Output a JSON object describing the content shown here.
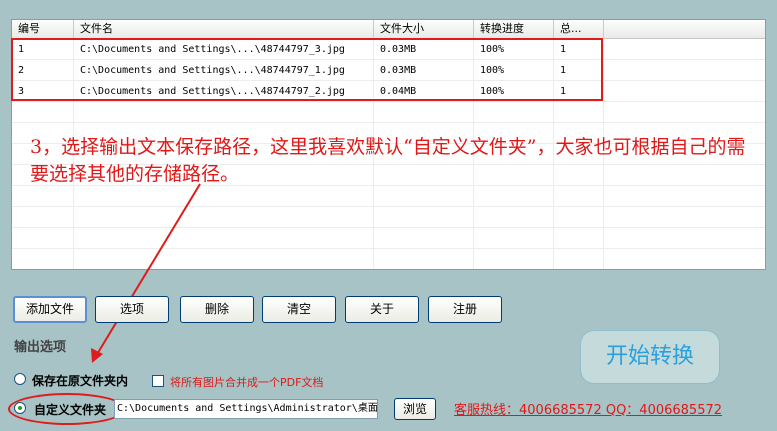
{
  "grid": {
    "columns": [
      "编号",
      "文件名",
      "文件大小",
      "转换进度",
      "总..."
    ],
    "rows": [
      [
        "1",
        "C:\\Documents and Settings\\...\\48744797_3.jpg",
        "0.03MB",
        "100%",
        "1"
      ],
      [
        "2",
        "C:\\Documents and Settings\\...\\48744797_1.jpg",
        "0.03MB",
        "100%",
        "1"
      ],
      [
        "3",
        "C:\\Documents and Settings\\...\\48744797_2.jpg",
        "0.04MB",
        "100%",
        "1"
      ]
    ]
  },
  "annotation": {
    "note": "3，选择输出文本保存路径，这里我喜欢默认“自定义文件夹”，大家也可根据自己的需要选择其他的存储路径。",
    "color": "#e01818"
  },
  "toolbar": {
    "add_file": "添加文件",
    "options": "选项",
    "delete": "删除",
    "clear": "清空",
    "about": "关于",
    "register": "注册"
  },
  "output": {
    "section_label": "输出选项",
    "save_in_original": "保存在原文件夹内",
    "merge_pdf": "将所有图片合并成一个PDF文档",
    "custom_folder": "自定义文件夹",
    "path_value": "C:\\Documents and Settings\\Administrator\\桌面",
    "browse": "浏览"
  },
  "start_button": "开始转换",
  "hotline": "客服热线：4006685572 QQ：4006685572"
}
